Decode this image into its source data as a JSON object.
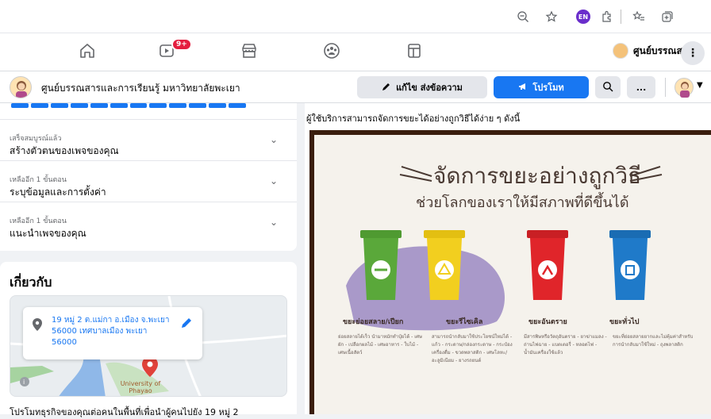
{
  "browser": {
    "extension_badge": "EN",
    "icons": [
      "zoom-out-icon",
      "favorite-star-icon",
      "extensions-icon",
      "favorites-icon",
      "collections-icon"
    ]
  },
  "fbnav": {
    "watch_badge": "9+",
    "page_switch_label": "ศูนย์บรรณส...",
    "icons": [
      "home-icon",
      "watch-icon",
      "marketplace-icon",
      "groups-icon",
      "gaming-icon"
    ]
  },
  "page_header": {
    "name": "ศูนย์บรรณสารและการเรียนรู้ มหาวิทยาลัยพะเยา",
    "edit_send_label": "แก้ไข ส่งข้อความ",
    "promote_label": "โปรโมท",
    "more_label": "..."
  },
  "setup_tasks": [
    {
      "status": "เสร็จสมบูรณ์แล้ว",
      "title": "สร้างตัวตนของเพจของคุณ"
    },
    {
      "status": "เหลืออีก 1 ขั้นตอน",
      "title": "ระบุข้อมูลและการตั้งค่า"
    },
    {
      "status": "เหลืออีก 1 ขั้นตอน",
      "title": "แนะนำเพจของคุณ"
    }
  ],
  "setup_progress": 1.0,
  "about": {
    "title": "เกี่ยวกับ",
    "address": "19 หมู่ 2 ต.แม่กา อ.เมือง จ.พะเยา 56000 เทศบาลเมือง พะเยา 56000",
    "map_label": "University of Phayao",
    "description": "โปรโมทธุรกิจของคุณต่อคนในพื้นที่เพื่อนำผู้คนไปยัง 19 หมู่ 2"
  },
  "post": {
    "text": "ผู้ใช้บริการสามารถจัดการขยะได้อย่างถูกวิธีได้ง่าย ๆ ดังนี้",
    "poster_title": "จัดการขยะอย่างถูกวิธี",
    "poster_subtitle": "ช่วยโลกของเราให้มีสภาพที่ดีขึ้นได้",
    "bins": [
      {
        "label": "ขยะย่อยสลาย/เปียก",
        "color": "#5aa83a",
        "desc": "ย่อยสลายได้เร็ว นำมาหมักทำปุ๋ยได้ - เศษผัก - เปลือกผลไม้ - เศษอาหาร - ใบไม้ - เศษเนื้อสัตว์"
      },
      {
        "label": "ขยะรีไซเคิล",
        "color": "#f2cf1f",
        "desc": "สามารถนำกลับมาใช้ประโยชน์ใหม่ได้ - แก้ว - กระดาษ/กล่องกระดาษ - กระป๋องเครื่องดื่ม - ขวดพลาสติก - เศษโลหะ/อะลูมิเนียม - ยางรถยนต์"
      },
      {
        "label": "ขยะอันตราย",
        "color": "#e0252a",
        "desc": "มีสารพิษหรือวัตถุอันตราย - ยาฆ่าแมลง - ถ่านไฟฉาย - แบตเตอรี่ - หลอดไฟ - น้ำมันเครื่องใช้แล้ว"
      },
      {
        "label": "ขยะทั่วไป",
        "color": "#1f7ac9",
        "desc": "ขยะที่ย่อยสลายยากและไม่คุ้มค่าสำหรับการนำกลับมาใช้ใหม่ - ถุงพลาสติก"
      }
    ]
  }
}
